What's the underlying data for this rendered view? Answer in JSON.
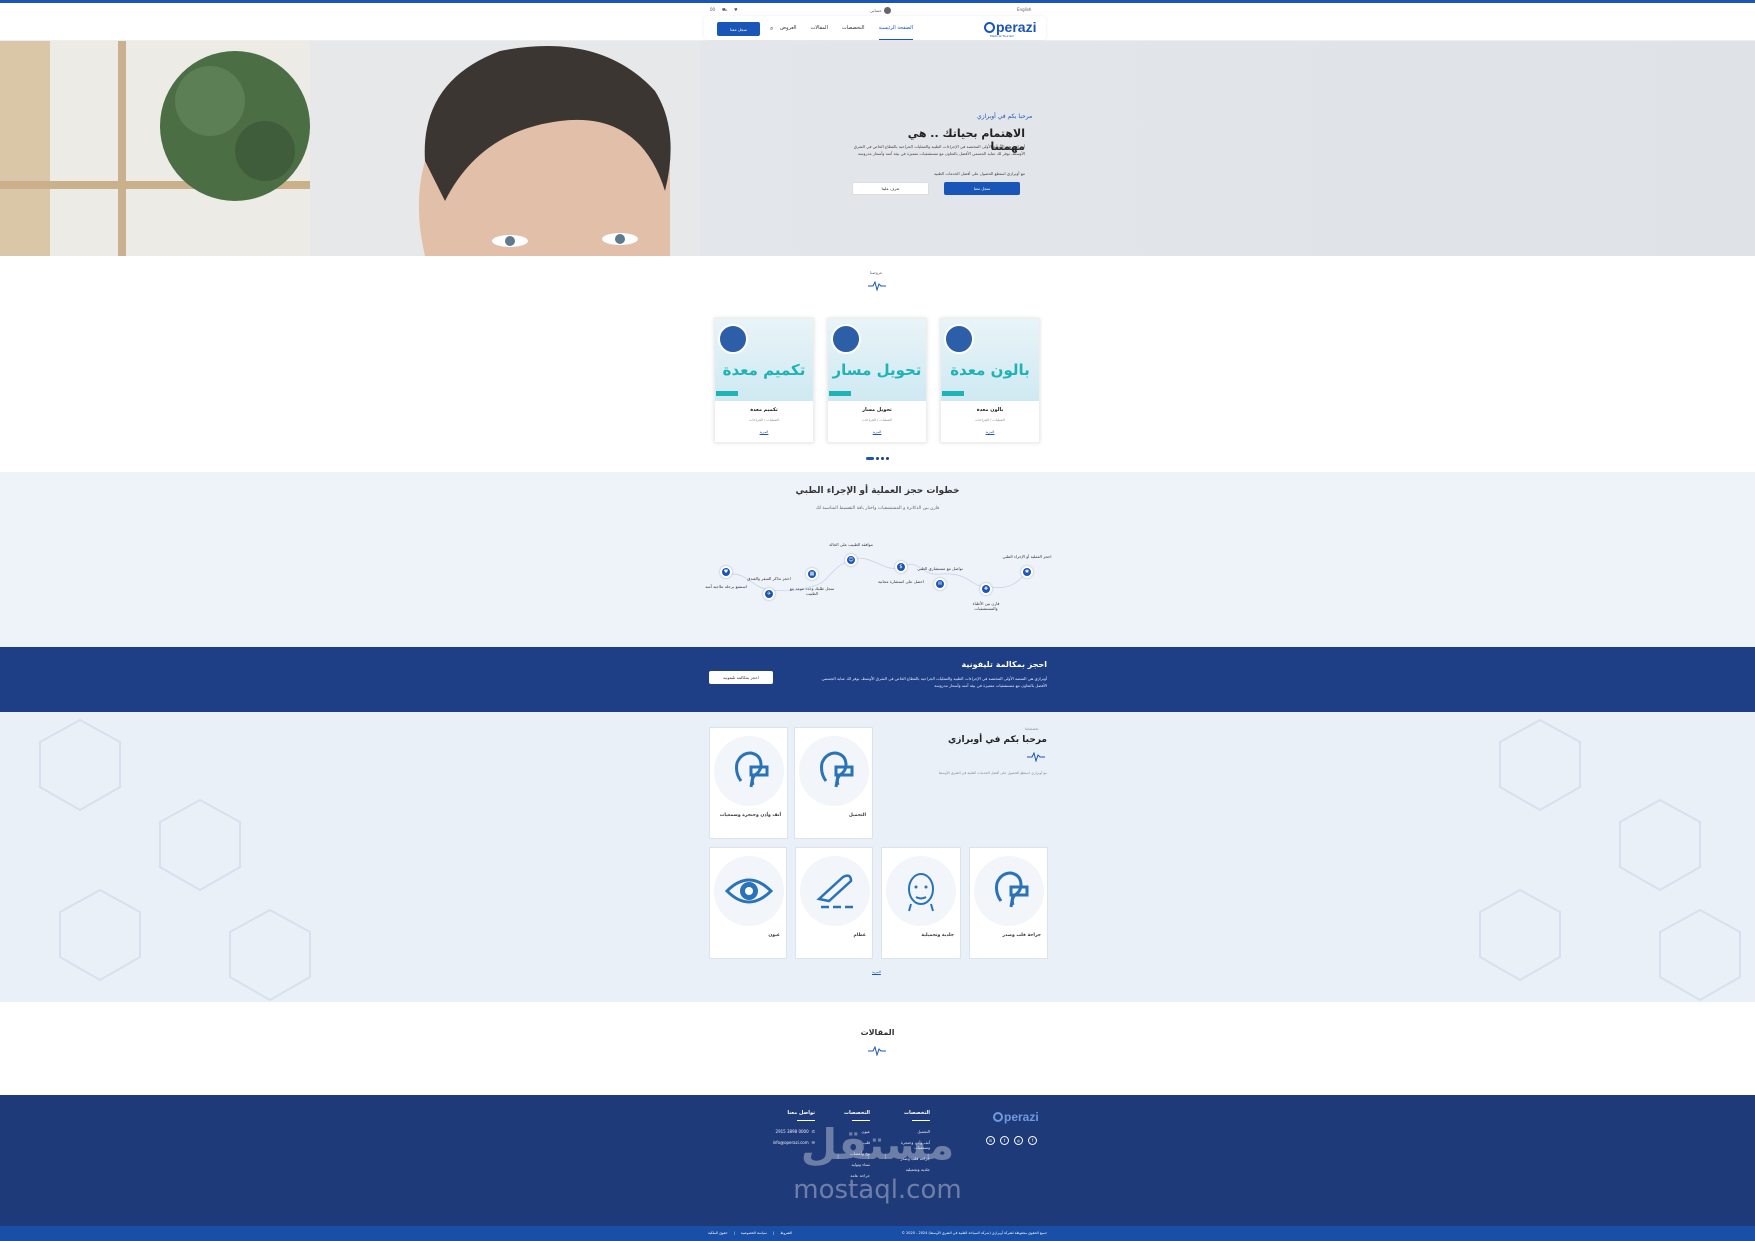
{
  "header": {
    "lang": "English",
    "account": "حسابي",
    "wishlist_icon": "heart-icon",
    "cart_icon": "cart-icon",
    "phone": "00",
    "nav": [
      "الصفحة الرئيسية",
      "التخصصات",
      "المقالات",
      "العروض"
    ],
    "cta": "سجل معنا",
    "logo": "perazi",
    "logo_sub": "Medical Tourism"
  },
  "hero": {
    "kicker": "مرحبا بكم في أوبرازي",
    "title": "الاهتمام بحياتك .. هي مهمتنا",
    "desc": "أوبرازي هي المنصة الأولى المختصة في الإجراءات الطبية والعمليات الجراحية بالقطاع الخاص في الشرق الأوسط، نوفر لك عناية الجسمي الأفضل بالتعاون مع مستشفيات متميزة في بيئة آمنة وأسعار مدروسة",
    "desc2": "مع أوبرازي استطع الحصول على أفضل الخدمات الطبية",
    "btn_primary": "سجل معنا",
    "btn_secondary": "تعرف علينا"
  },
  "offers": {
    "kicker": "عروضنا",
    "cards": [
      {
        "image_text": "بالون معدة",
        "title": "بالون معدة",
        "meta": "العمليات / الجراحات",
        "link": "المزيد"
      },
      {
        "image_text": "تحويل مسار",
        "title": "تحويل مسار",
        "meta": "العمليات / الجراحات",
        "link": "المزيد"
      },
      {
        "image_text": "تكميم معدة",
        "title": "تكميم معدة",
        "meta": "العمليات / الجراحات",
        "link": "المزيد"
      }
    ]
  },
  "steps": {
    "title": "خطوات حجز العملية أو الإجراء الطبي",
    "subtitle": "قارن بين الدكاترة و المستشفيات واختار باقة التقسيط المناسبة لك",
    "items": [
      {
        "label": "احجز العملية أو الإجراء الطبي",
        "icon": "lightbulb-icon"
      },
      {
        "label": "قارن بين الأطباء والمستشفيات",
        "icon": "hospital-icon"
      },
      {
        "label": "تواصل مع مستشاري الطبي",
        "icon": "chat-icon"
      },
      {
        "label": "احصل على استشارة مجانية",
        "icon": "money-icon"
      },
      {
        "label": "موافقة الطبيب على الحالة",
        "icon": "doctor-icon"
      },
      {
        "label": "سجل طلبك وحدد موعد مع الطبيب",
        "icon": "calendar-icon"
      },
      {
        "label": "احجز تذاكر السفر والفندق",
        "icon": "plane-icon"
      },
      {
        "label": "استمتع برحلة علاجية آمنة",
        "icon": "heart-icon"
      }
    ]
  },
  "cta": {
    "title": "احجز بمكالمة تليفونية",
    "desc": "أوبرازي هي المنصة الأولى المختصة في الإجراءات الطبية والعمليات الجراحية بالقطاع الخاص في الشرق الأوسط، نوفر لك عناية الجسمي الأفضل بالتعاون مع مستشفيات متميزة في بيئة آمنة وأسعار مدروسة",
    "button": "احجز بمكالمة تليفونية"
  },
  "services": {
    "kicker": "تخصصاتنا",
    "title": "مرحبا بكم في أوبرازي",
    "desc": "مع أوبرازي استطع الحصول على أفضل الخدمات الطبية في الشرق الأوسط",
    "cards_top": [
      {
        "label": "التجميل",
        "icon": "ear-icon"
      },
      {
        "label": "أنف وأذن وحنجرة وسمعيات",
        "icon": "ear-icon"
      }
    ],
    "cards_bottom": [
      {
        "label": "جراحة قلب وصدر",
        "icon": "ear-icon"
      },
      {
        "label": "جلدية وتجميلية",
        "icon": "face-icon"
      },
      {
        "label": "عظام",
        "icon": "scalpel-icon"
      },
      {
        "label": "عيون",
        "icon": "eye-icon"
      }
    ],
    "more": "المزيد"
  },
  "articles": {
    "title": "المقالات"
  },
  "footer": {
    "logo": "perazi",
    "col1": {
      "title": "التخصصات",
      "items": [
        "التجميل",
        "أنف وأذن وحنجرة وسمعيات",
        "جراحة قلب وصدر",
        "جلدية وتجميلية"
      ]
    },
    "col2": {
      "title": "التخصصات",
      "items": [
        "عيون",
        "قلب",
        "مخ وأعصاب",
        "نساء وتوليد",
        "جراحة عامة"
      ]
    },
    "col3": {
      "title": "تواصل معنا",
      "phone": "2915 3898 0000",
      "email": "info@operazi.com"
    },
    "social": [
      "facebook-icon",
      "instagram-icon",
      "twitter-icon",
      "linkedin-icon"
    ],
    "copyright": "© 2020 - 2024 جميع الحقوق محفوظة لشركة أوبرازي (شركة السياحة الطبية في الشرق الأوسط)",
    "links": [
      "الشروط",
      "سياسة الخصوصية",
      "حقوق الملكية"
    ],
    "watermark": "مستقل",
    "watermark_url": "mostaql.com"
  }
}
